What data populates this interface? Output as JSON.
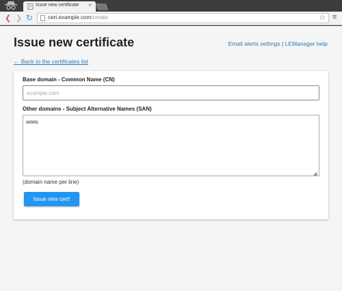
{
  "browser": {
    "tab_title": "Issue new certificate",
    "tab_close": "×",
    "url_host": "cert.example.com",
    "url_path": "/create",
    "back_glyph": "❮",
    "forward_glyph": "❯",
    "reload_glyph": "↻",
    "star_glyph": "☆",
    "menu_glyph": "≡",
    "icons": {
      "incognito": "incognito-icon",
      "favicon": "document-favicon-icon",
      "page": "page-icon",
      "star": "star-icon",
      "menu": "hamburger-menu-icon"
    }
  },
  "header": {
    "title": "Issue new certificate",
    "links": [
      {
        "label": "Email alerts settings"
      },
      {
        "label": "LEManager help"
      }
    ],
    "link_separator": " | "
  },
  "back_link": {
    "label": "← Back to the certificates list"
  },
  "form": {
    "cn_label": "Base domain - Common Name (CN)",
    "cn_placeholder": "example.com",
    "cn_value": "",
    "san_label": "Other domains - Subject Alternative Names (SAN)",
    "san_value": "www.",
    "san_hint": "(domain name per line)",
    "submit_label": "Issue new cert!"
  },
  "colors": {
    "accent": "#2196f3",
    "link": "#2a7ab8",
    "page_bg": "#f5f5f5",
    "chrome_dark": "#3d3d3d"
  }
}
